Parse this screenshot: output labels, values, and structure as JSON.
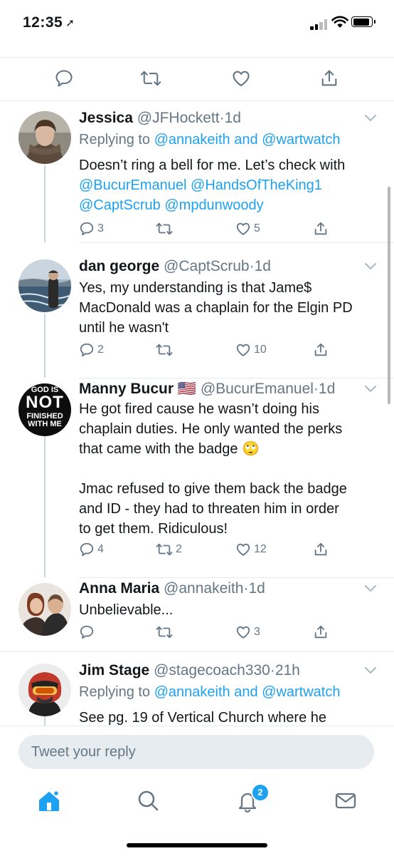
{
  "status_bar": {
    "time": "12:35",
    "location_icon": "➚"
  },
  "tweets": [
    {
      "name": "Jessica",
      "handle": "@JFHockett",
      "dot": "·",
      "time": "1d",
      "replying_prefix": "Replying to",
      "replying_users": "@annakeith and @wartwatch",
      "body_line1": "Doesn’t ring a bell for me. Let’s check with",
      "body_line2": "@BucurEmanuel @HandsOfTheKing1",
      "body_line3": "@CaptScrub @mpdunwoody",
      "replies": "3",
      "retweets": "",
      "likes": "5"
    },
    {
      "name": "dan george",
      "handle": "@CaptScrub",
      "dot": "·",
      "time": "1d",
      "body_line1": "Yes, my understanding is that Jame$",
      "body_line2": "MacDonald was a chaplain for the Elgin PD",
      "body_line3": "until he wasn't",
      "replies": "2",
      "retweets": "",
      "likes": "10"
    },
    {
      "name": "Manny Bucur",
      "flag": "🇺🇸",
      "handle": "@BucurEmanuel",
      "dot": "·",
      "time": "1d",
      "avatar_text_top": "GOD IS",
      "avatar_text_mid": "NOT",
      "avatar_text_bot1": "FINISHED",
      "avatar_text_bot2": "WITH ME",
      "body_line1": "He got fired cause he wasn’t doing his",
      "body_line2": "chaplain duties. He only wanted the perks",
      "body_line3": "that came with the badge 🙄",
      "body_line4": "Jmac refused to give them back the badge",
      "body_line5": "and ID - they had to threaten him in order",
      "body_line6": "to get them. Ridiculous!",
      "replies": "4",
      "retweets": "2",
      "likes": "12"
    },
    {
      "name": "Anna Maria",
      "handle": "@annakeith",
      "dot": "·",
      "time": "1d",
      "body_line1": "Unbelievable...",
      "replies": "",
      "retweets": "",
      "likes": "3"
    },
    {
      "name": "Jim Stage",
      "handle": "@stagecoach330",
      "dot": "·",
      "time": "21h",
      "replying_prefix": "Replying to",
      "replying_users": "@annakeith and @wartwatch",
      "body_line1": "See pg. 19 of Vertical Church where he"
    }
  ],
  "composer": {
    "placeholder": "Tweet your reply"
  },
  "tab_bar": {
    "notifications_badge": "2"
  },
  "colors": {
    "accent": "#1da1f2",
    "secondary_text": "#657786",
    "divider": "#e6ecf0"
  }
}
